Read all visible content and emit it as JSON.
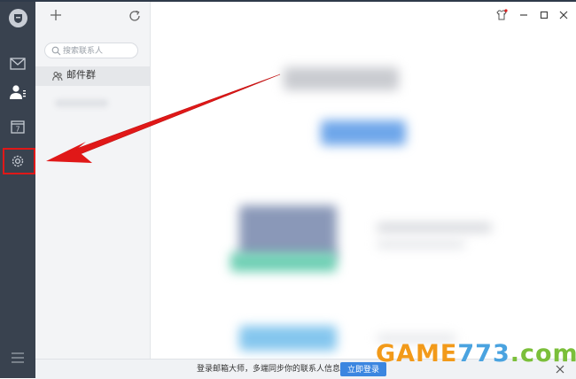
{
  "sidebar": {
    "icons": [
      "logo-icon",
      "mail-icon",
      "contacts-icon",
      "calendar-icon",
      "gear-icon",
      "menu-icon"
    ],
    "calendar_day": "7"
  },
  "contacts_panel": {
    "search_placeholder": "搜索联系人",
    "group_label": "邮件群"
  },
  "bottom_bar": {
    "message": "登录邮箱大师，多端同步你的联系人信息",
    "login_button": "立即登录"
  },
  "watermark": {
    "game": "GAME",
    "number": "773",
    "domain": ".com"
  },
  "colors": {
    "rail": "#39424f",
    "panel": "#f3f4f6",
    "accent": "#3b86e0",
    "annotation": "#e01818"
  }
}
